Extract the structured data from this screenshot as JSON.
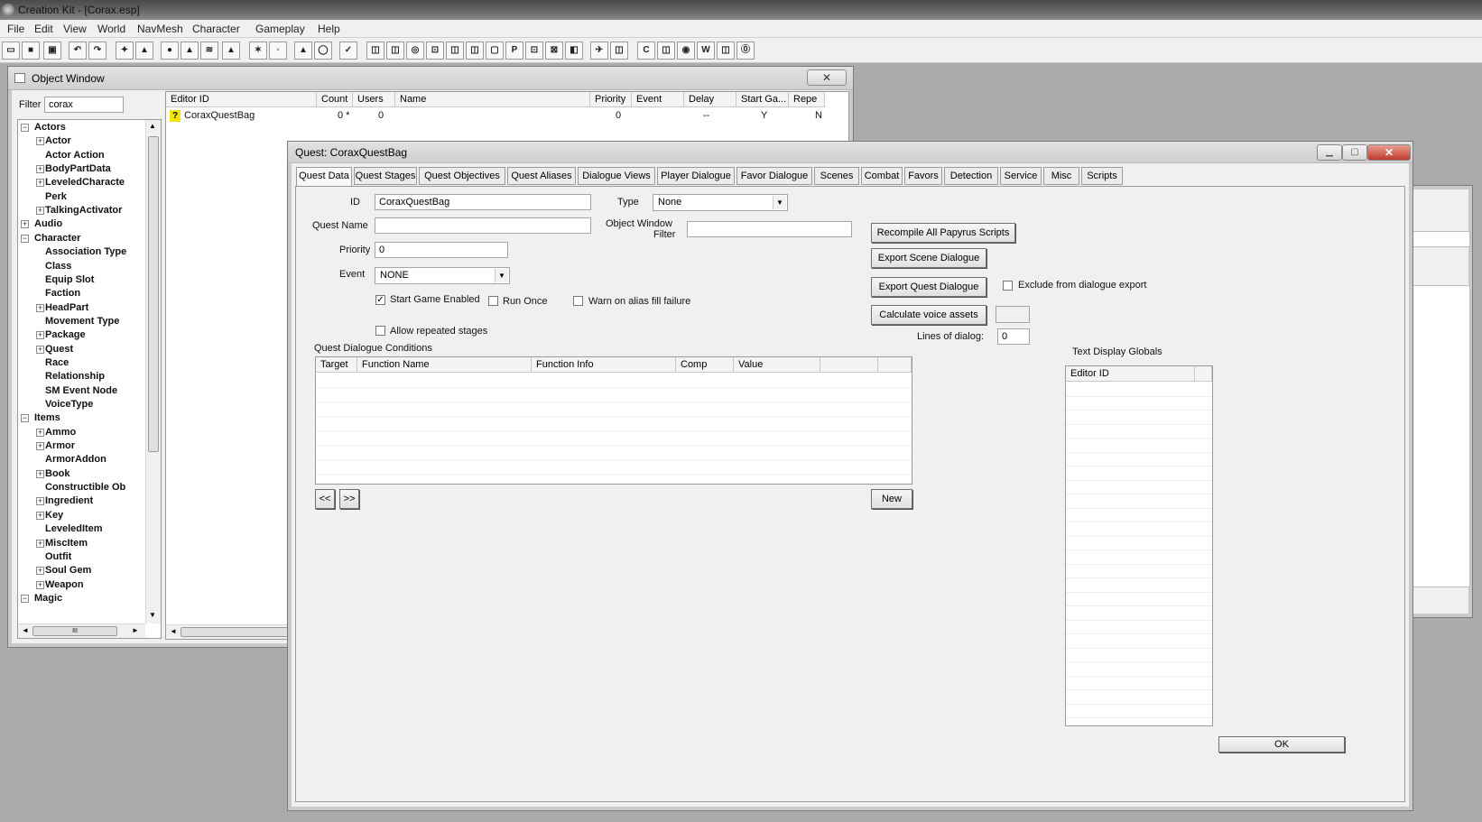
{
  "app": {
    "title": "Creation Kit - [Corax.esp]",
    "menu": [
      "File",
      "Edit",
      "View",
      "World",
      "NavMesh",
      "Character",
      "Gameplay",
      "Help"
    ],
    "toolbar_glyphs": [
      "▭",
      "■",
      "▣",
      "↶",
      "↷",
      "✦",
      "▲",
      "●",
      "▲",
      "≋",
      "▲",
      "✶",
      "◦",
      "▲",
      "◯",
      "✓",
      "◫",
      "◫",
      "◎",
      "⊡",
      "◫",
      "◫",
      "▢",
      "P",
      "⊡",
      "⊠",
      "◧",
      "✈",
      "◫",
      "C",
      "◫",
      "◉",
      "W",
      "◫",
      "⓪"
    ]
  },
  "object_window": {
    "title": "Object Window",
    "close": "✕",
    "filter_label": "Filter",
    "filter_value": "corax",
    "tree": [
      {
        "label": "Actors",
        "level": 0,
        "exp": "−"
      },
      {
        "label": "Actor",
        "level": 1,
        "exp": "+"
      },
      {
        "label": "Actor Action",
        "level": 1,
        "exp": ""
      },
      {
        "label": "BodyPartData",
        "level": 1,
        "exp": "+"
      },
      {
        "label": "LeveledCharacte",
        "level": 1,
        "exp": "+"
      },
      {
        "label": "Perk",
        "level": 1,
        "exp": ""
      },
      {
        "label": "TalkingActivator",
        "level": 1,
        "exp": "+"
      },
      {
        "label": "Audio",
        "level": 0,
        "exp": "+"
      },
      {
        "label": "Character",
        "level": 0,
        "exp": "−"
      },
      {
        "label": "Association Type",
        "level": 1,
        "exp": ""
      },
      {
        "label": "Class",
        "level": 1,
        "exp": ""
      },
      {
        "label": "Equip Slot",
        "level": 1,
        "exp": ""
      },
      {
        "label": "Faction",
        "level": 1,
        "exp": ""
      },
      {
        "label": "HeadPart",
        "level": 1,
        "exp": "+"
      },
      {
        "label": "Movement Type",
        "level": 1,
        "exp": ""
      },
      {
        "label": "Package",
        "level": 1,
        "exp": "+"
      },
      {
        "label": "Quest",
        "level": 1,
        "exp": "+"
      },
      {
        "label": "Race",
        "level": 1,
        "exp": ""
      },
      {
        "label": "Relationship",
        "level": 1,
        "exp": ""
      },
      {
        "label": "SM Event Node",
        "level": 1,
        "exp": ""
      },
      {
        "label": "VoiceType",
        "level": 1,
        "exp": ""
      },
      {
        "label": "Items",
        "level": 0,
        "exp": "−"
      },
      {
        "label": "Ammo",
        "level": 1,
        "exp": "+"
      },
      {
        "label": "Armor",
        "level": 1,
        "exp": "+"
      },
      {
        "label": "ArmorAddon",
        "level": 1,
        "exp": ""
      },
      {
        "label": "Book",
        "level": 1,
        "exp": "+"
      },
      {
        "label": "Constructible Ob",
        "level": 1,
        "exp": ""
      },
      {
        "label": "Ingredient",
        "level": 1,
        "exp": "+"
      },
      {
        "label": "Key",
        "level": 1,
        "exp": "+"
      },
      {
        "label": "LeveledItem",
        "level": 1,
        "exp": ""
      },
      {
        "label": "MiscItem",
        "level": 1,
        "exp": "+"
      },
      {
        "label": "Outfit",
        "level": 1,
        "exp": ""
      },
      {
        "label": "Soul Gem",
        "level": 1,
        "exp": "+"
      },
      {
        "label": "Weapon",
        "level": 1,
        "exp": "+"
      },
      {
        "label": "Magic",
        "level": 0,
        "exp": "−"
      }
    ],
    "columns": [
      "Editor ID",
      "Count",
      "Users",
      "Name",
      "Priority",
      "Event",
      "Delay",
      "Start Ga...",
      "Repe"
    ],
    "row": {
      "icon": "?",
      "editor_id": "CoraxQuestBag",
      "count": "0 *",
      "users": "0",
      "name": "",
      "priority": "0",
      "event": "",
      "delay": "--",
      "start": "Y",
      "repeat": "N"
    },
    "hscroll_grip": "III"
  },
  "quest_window": {
    "title": "Quest: CoraxQuestBag",
    "tabs": [
      "Quest Data",
      "Quest Stages",
      "Quest Objectives",
      "Quest Aliases",
      "Dialogue Views",
      "Player Dialogue",
      "Favor Dialogue",
      "Scenes",
      "Combat",
      "Favors",
      "Detection",
      "Service",
      "Misc",
      "Scripts"
    ],
    "active_tab": "Quest Data",
    "id_label": "ID",
    "id_value": "CoraxQuestBag",
    "type_label": "Type",
    "type_value": "None",
    "quest_name_label": "Quest Name",
    "quest_name_value": "",
    "object_window_filter_label_1": "Object Window",
    "object_window_filter_label_2": "Filter",
    "object_window_filter_value": "",
    "priority_label": "Priority",
    "priority_value": "0",
    "event_label": "Event",
    "event_value": "NONE",
    "start_game_enabled": {
      "label": "Start Game Enabled",
      "checked": true
    },
    "run_once": {
      "label": "Run Once",
      "checked": false
    },
    "warn_alias": {
      "label": "Warn on alias fill failure",
      "checked": false
    },
    "allow_repeated": {
      "label": "Allow repeated stages",
      "checked": false
    },
    "recompile_button": "Recompile All Papyrus Scripts",
    "export_scene_button": "Export Scene Dialogue",
    "export_quest_button": "Export Quest Dialogue",
    "exclude_export": {
      "label": "Exclude from dialogue export",
      "checked": false
    },
    "calc_voice_button": "Calculate voice assets",
    "lines_of_dialog_label": "Lines of dialog:",
    "lines_of_dialog_value": "0",
    "conditions_label": "Quest Dialogue Conditions",
    "conditions_columns": [
      "Target",
      "Function Name",
      "Function Info",
      "Comp",
      "Value"
    ],
    "prev_button": "<<",
    "next_button": ">>",
    "new_button": "New",
    "text_display_label": "Text Display Globals",
    "text_display_column": "Editor ID",
    "ok_button": "OK"
  }
}
